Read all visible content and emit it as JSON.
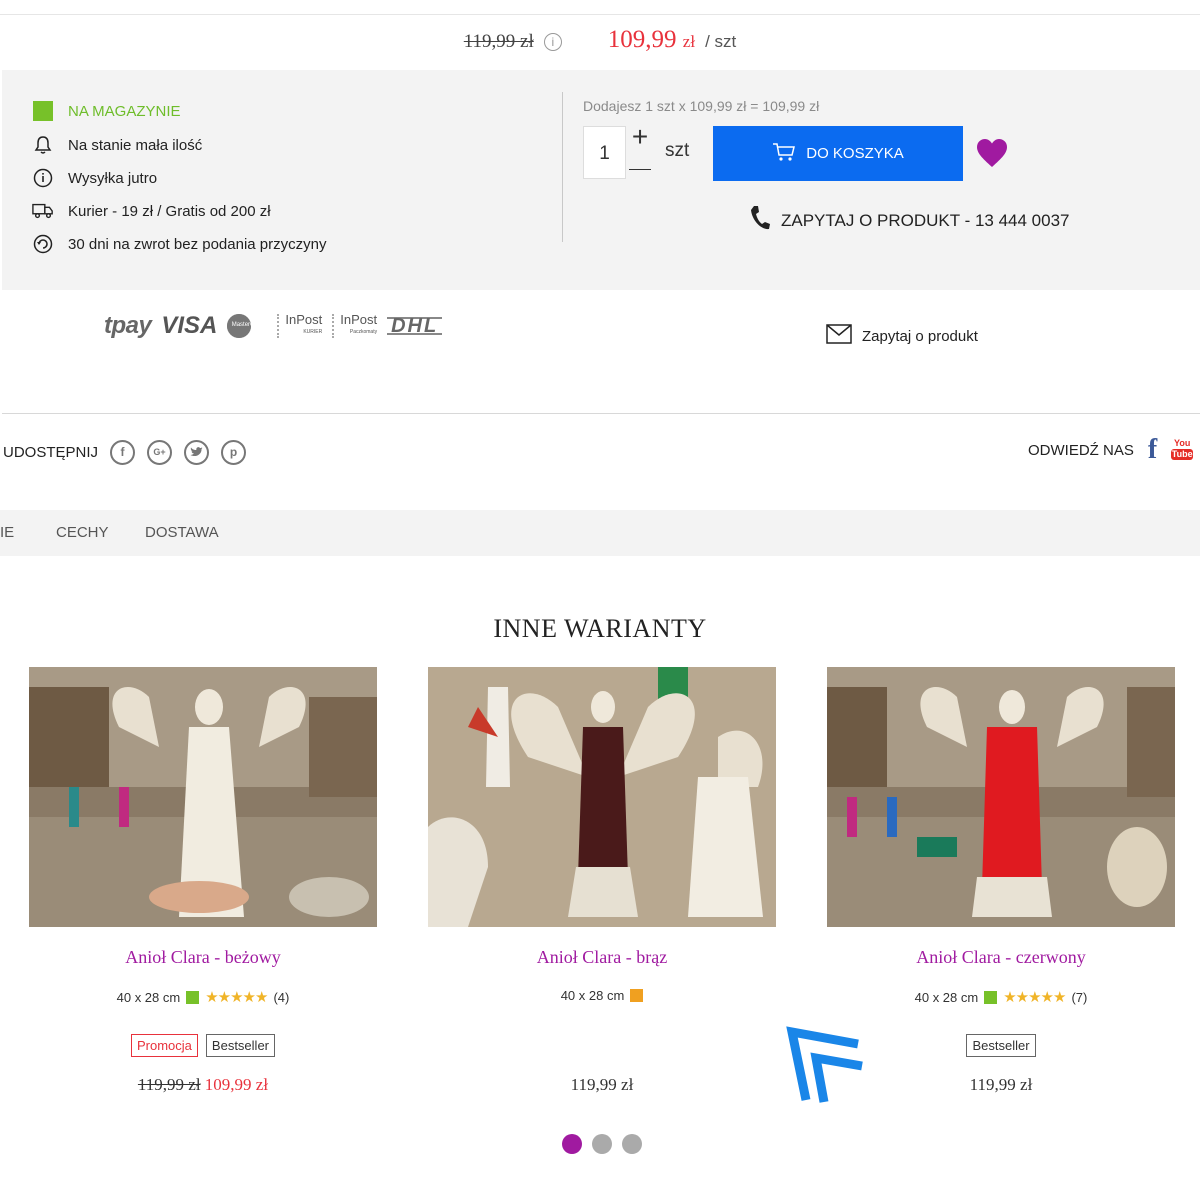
{
  "price": {
    "old": "119,99 zł",
    "info_icon": "info-icon",
    "new": "109,99",
    "currency": "zł",
    "unit": "/ szt"
  },
  "availability": {
    "stock_label": "NA MAGAZYNIE",
    "stock_color": "#77c129",
    "items": [
      {
        "icon": "bell-icon",
        "text": "Na stanie mała ilość"
      },
      {
        "icon": "info-circle-icon",
        "text": "Wysyłka jutro"
      },
      {
        "icon": "truck-icon",
        "text": "Kurier - 19 zł / Gratis od 200 zł"
      },
      {
        "icon": "return-icon",
        "text": "30 dni na zwrot bez podania przyczyny"
      }
    ]
  },
  "purchase": {
    "summary": "Dodajesz 1 szt x 109,99 zł = 109,99 zł",
    "quantity": "1",
    "plus": "+",
    "unit": "szt",
    "cart_button": "DO KOSZYKA",
    "ask_product": "ZAPYTAJ O PRODUKT - 13 444 0037",
    "accent": "#0b6bf0",
    "heart_color": "#a01aa0"
  },
  "payments": {
    "tpay": "tpay",
    "visa": "VISA",
    "mastercard": "MasterCard",
    "inpost1": "InPost",
    "inpost1_sub": "KURIER",
    "inpost2": "InPost",
    "inpost2_sub": "Paczkomaty",
    "dhl": "DHL",
    "email_link": "Zapytaj o produkt"
  },
  "share": {
    "label": "UDOSTĘPNIJ",
    "icons": [
      "facebook-icon",
      "google-plus-icon",
      "twitter-icon",
      "pinterest-icon"
    ],
    "visit_label": "ODWIEDŹ NAS",
    "fb": "f",
    "yt_top": "You",
    "yt_bottom": "Tube"
  },
  "tabs": [
    "IE",
    "CECHY",
    "DOSTAWA"
  ],
  "variants": {
    "title": "INNE WARIANTY",
    "items": [
      {
        "name": "Anioł Clara - beżowy",
        "size": "40 x 28 cm",
        "avail_color": "#77c129",
        "stars": "★★★★★",
        "reviews": "(4)",
        "badges": [
          "Promocja",
          "Bestseller"
        ],
        "old_price": "119,99 zł",
        "price": "109,99 zł"
      },
      {
        "name": "Anioł Clara - brąz",
        "size": "40 x 28 cm",
        "avail_color": "#f0a020",
        "price": "119,99 zł"
      },
      {
        "name": "Anioł Clara - czerwony",
        "size": "40 x 28 cm",
        "avail_color": "#77c129",
        "stars": "★★★★★",
        "reviews": "(7)",
        "badges": [
          "Bestseller"
        ],
        "price": "119,99 zł"
      }
    ]
  },
  "carousel": {
    "pages": 3,
    "active": 1
  }
}
